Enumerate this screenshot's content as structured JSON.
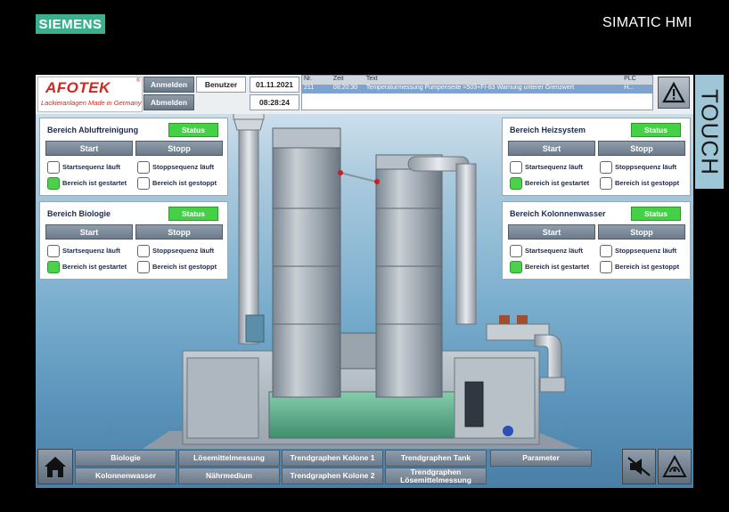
{
  "bezel": {
    "brand": "SIEMENS",
    "product": "SIMATIC HMI",
    "touch_label": "TOUCH"
  },
  "header": {
    "logo_name": "AFOTEK",
    "logo_reg": "®",
    "logo_tagline": "Lackieranlagen Made in Germany",
    "login_label": "Anmelden",
    "logout_label": "Abmelden",
    "user_label": "Benutzer",
    "date": "01.11.2021",
    "time": "08:28:24"
  },
  "alarms": {
    "columns": [
      "Nr.",
      "Zeit",
      "Text",
      "PLC"
    ],
    "rows": [
      {
        "nr": "211",
        "time": "08:20:30",
        "text": "Temperaturmessung  Pumpenseite =503+FI-83 Warnung unterer Grenzwert",
        "plc": "H..."
      }
    ]
  },
  "panels": [
    {
      "title": "Bereich Abluftreinigung",
      "status": "Status",
      "start": "Start",
      "stop": "Stopp",
      "chk1": "Startsequenz läuft",
      "chk2": "Stoppsequenz läuft",
      "chk3": "Bereich ist gestartet",
      "chk4": "Bereich ist gestoppt",
      "started": true
    },
    {
      "title": "Bereich Biologie",
      "status": "Status",
      "start": "Start",
      "stop": "Stopp",
      "chk1": "Startsequenz läuft",
      "chk2": "Stoppsequenz läuft",
      "chk3": "Bereich ist gestartet",
      "chk4": "Bereich ist gestoppt",
      "started": true
    },
    {
      "title": "Bereich Heizsystem",
      "status": "Status",
      "start": "Start",
      "stop": "Stopp",
      "chk1": "Startsequenz läuft",
      "chk2": "Stoppsequenz läuft",
      "chk3": "Bereich ist gestartet",
      "chk4": "Bereich ist gestoppt",
      "started": true
    },
    {
      "title": "Bereich Kolonnenwasser",
      "status": "Status",
      "start": "Start",
      "stop": "Stopp",
      "chk1": "Startsequenz läuft",
      "chk2": "Stoppsequenz läuft",
      "chk3": "Bereich ist gestartet",
      "chk4": "Bereich ist gestoppt",
      "started": true
    }
  ],
  "nav": {
    "home_icon": "home-icon",
    "biologie": "Biologie",
    "kolonnenwasser": "Kolonnenwasser",
    "loesemittelmessung": "Lösemittelmessung",
    "naehrmedium": "Nährmedium",
    "trend_k1": "Trendgraphen Kolone 1",
    "trend_k2": "Trendgraphen Kolone 2",
    "trend_tank": "Trendgraphen Tank",
    "trend_lm": "Trendgraphen Lösemittelmessung",
    "parameter": "Parameter",
    "mute_icon": "mute-icon",
    "acknowledge_icon": "acknowledge-icon"
  },
  "colors": {
    "status_green": "#45d145",
    "button_gray": "#7a8796",
    "logo_red": "#d3261c",
    "siemens_teal": "#3cb08e"
  }
}
